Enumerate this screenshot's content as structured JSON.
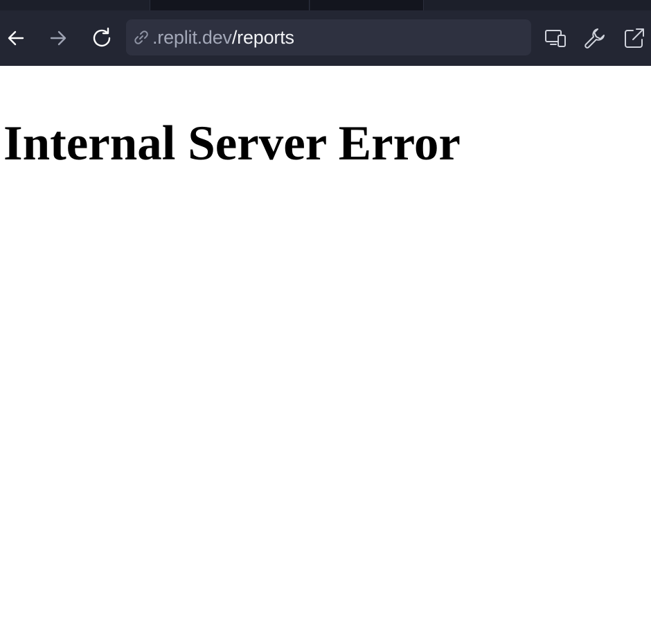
{
  "browser": {
    "toolbar": {
      "back_icon": "arrow-left-icon",
      "forward_icon": "arrow-right-icon",
      "reload_icon": "reload-icon",
      "devices_icon": "devices-icon",
      "devtools_icon": "wrench-icon",
      "open_new_tab_icon": "external-link-icon"
    },
    "url_bar": {
      "link_icon": "link-icon",
      "domain": ".replit.dev",
      "path": "/reports"
    },
    "colors": {
      "toolbar_bg": "#232633",
      "url_bar_bg": "#2e3140",
      "tab_strip_bg": "#1c1f2a"
    }
  },
  "page": {
    "heading": "Internal Server Error",
    "background": "#ffffff"
  }
}
